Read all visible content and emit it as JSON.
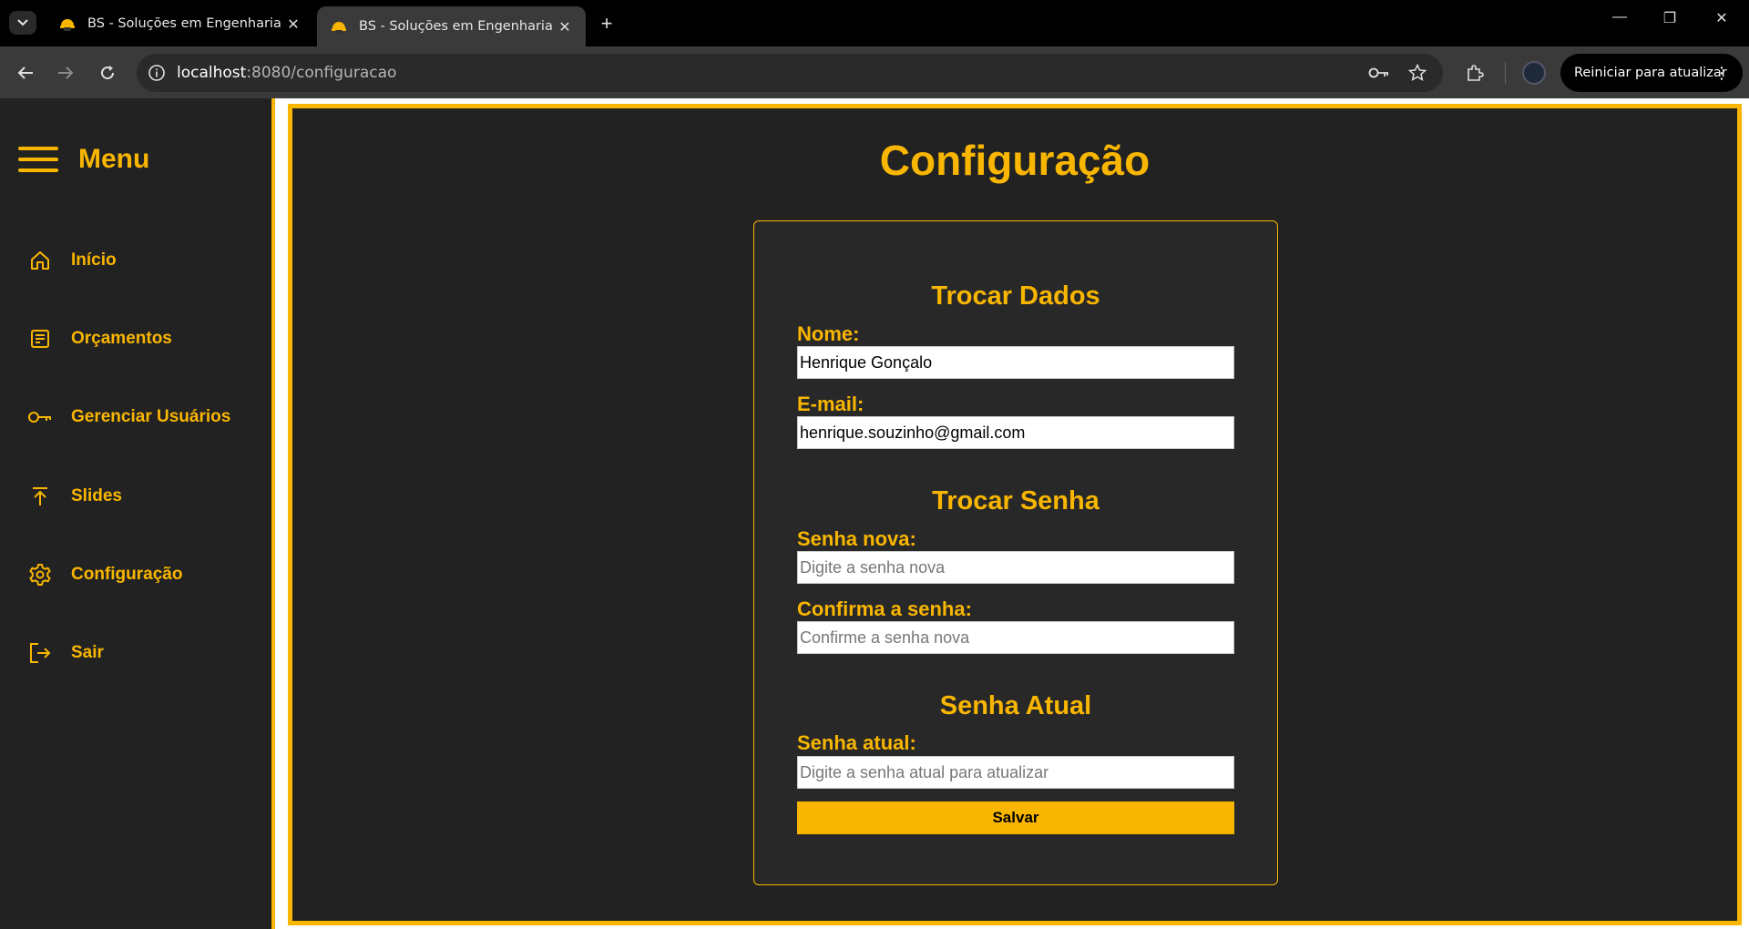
{
  "browser": {
    "tabs": [
      {
        "title": "BS - Soluções em Engenharia e",
        "active": false
      },
      {
        "title": "BS - Soluções em Engenharia e",
        "active": true
      }
    ],
    "url_host": "localhost",
    "url_path": ":8080/configuracao",
    "update_button": "Reiniciar para atualizar"
  },
  "sidebar": {
    "title": "Menu",
    "items": [
      {
        "label": "Início",
        "icon": "home-icon"
      },
      {
        "label": "Orçamentos",
        "icon": "document-icon"
      },
      {
        "label": "Gerenciar Usuários",
        "icon": "key-icon"
      },
      {
        "label": "Slides",
        "icon": "upload-icon"
      },
      {
        "label": "Configuração",
        "icon": "gear-icon"
      },
      {
        "label": "Sair",
        "icon": "logout-icon"
      }
    ]
  },
  "main": {
    "title": "Configuração",
    "sections": {
      "dados": {
        "title": "Trocar Dados",
        "nome_label": "Nome:",
        "nome_value": "Henrique Gonçalo",
        "email_label": "E-mail:",
        "email_value": "henrique.souzinho@gmail.com"
      },
      "senha": {
        "title": "Trocar Senha",
        "nova_label": "Senha nova:",
        "nova_placeholder": "Digite a senha nova",
        "confirma_label": "Confirma a senha:",
        "confirma_placeholder": "Confirme a senha nova"
      },
      "atual": {
        "title": "Senha Atual",
        "atual_label": "Senha atual:",
        "atual_placeholder": "Digite a senha atual para atualizar"
      }
    },
    "save_label": "Salvar"
  },
  "colors": {
    "accent": "#f9b600",
    "background": "#222222",
    "card": "#282828"
  }
}
